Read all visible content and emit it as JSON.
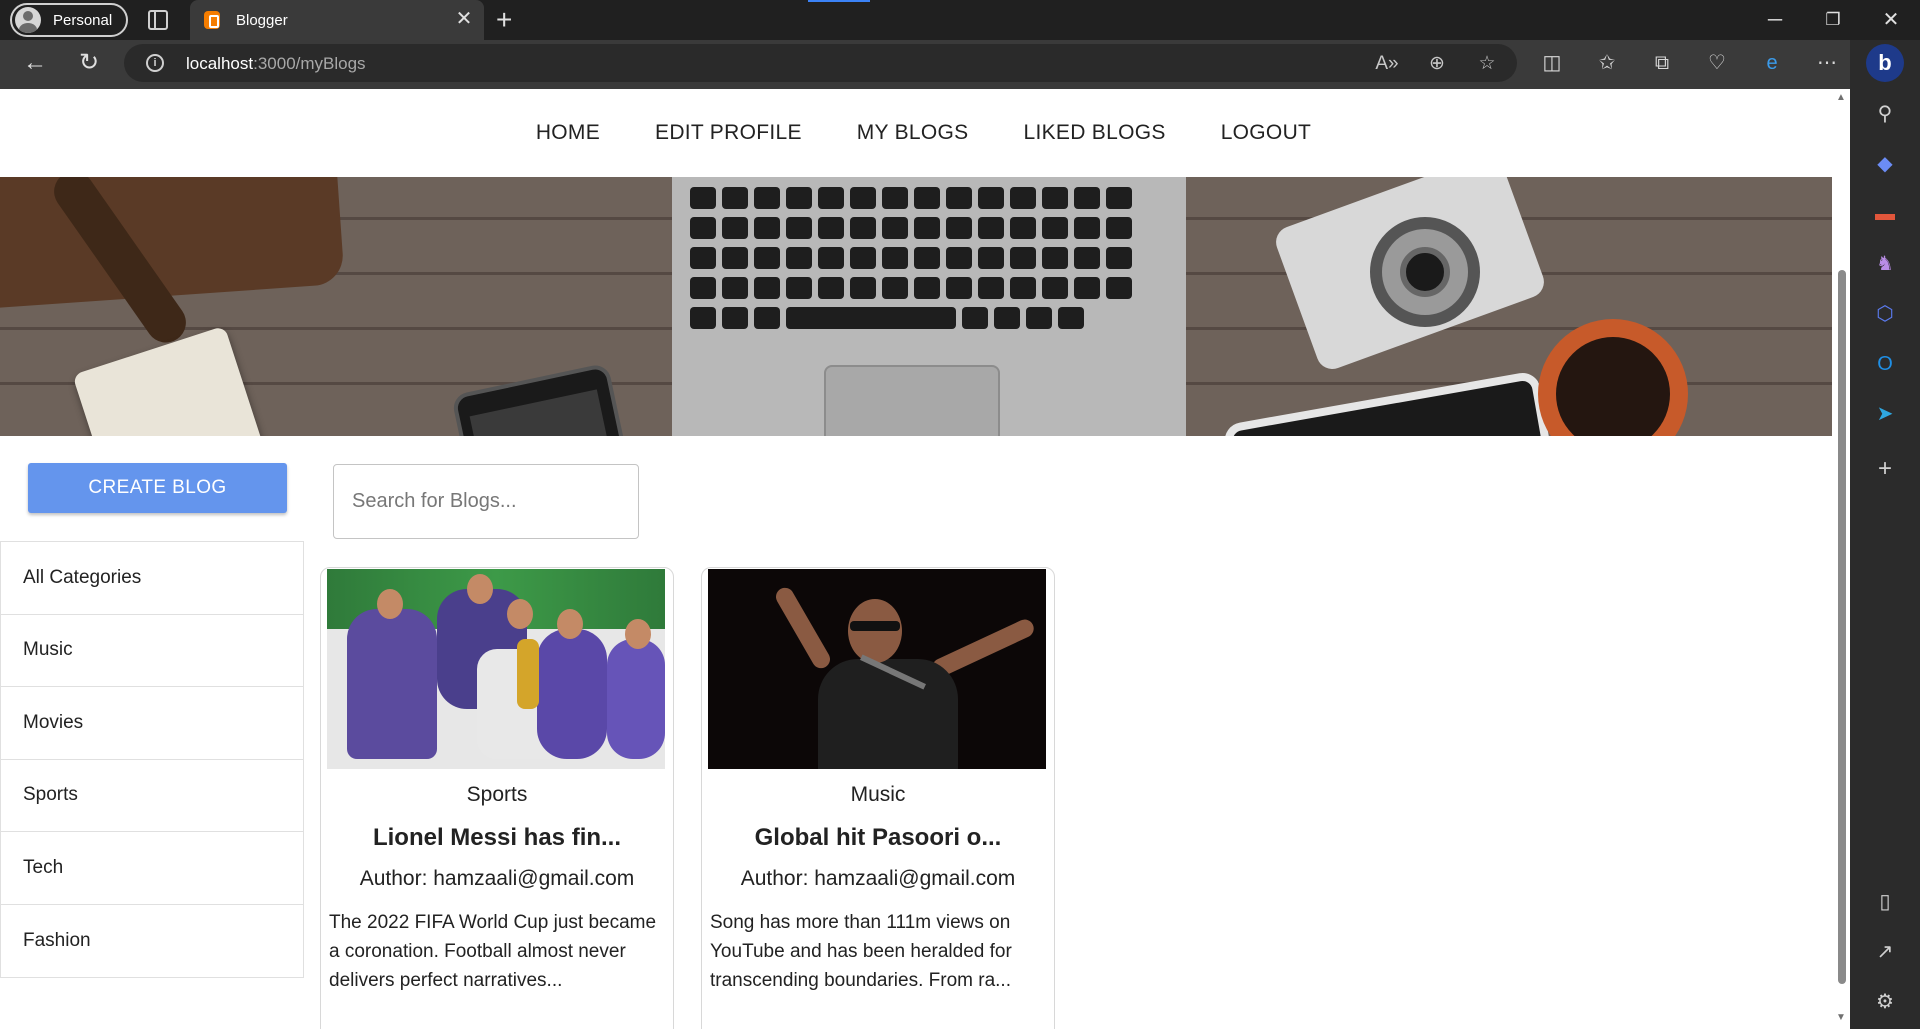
{
  "browser": {
    "profile_label": "Personal",
    "tab_title": "Blogger",
    "tab_close": "✕",
    "new_tab": "+",
    "window_controls": {
      "minimize": "─",
      "restore": "❐",
      "close": "✕"
    },
    "url_host": "localhost",
    "url_path": ":3000/myBlogs",
    "info_icon": "i",
    "icons": [
      "back-icon",
      "refresh-icon",
      "read-aloud-icon",
      "zoom-icon",
      "favorite-star-icon",
      "split-screen-icon",
      "favorites-icon",
      "collections-icon",
      "browser-essentials-icon",
      "edge-extension-icon",
      "more-icon"
    ]
  },
  "sidebar_icons": [
    "search-icon",
    "shopping-tag-icon",
    "tools-briefcase-icon",
    "games-icon",
    "copilot-icon",
    "outlook-icon",
    "send-icon",
    "add-icon",
    "sidebar-toggle-icon",
    "external-link-icon",
    "settings-icon"
  ],
  "nav": {
    "home": "HOME",
    "edit_profile": "EDIT PROFILE",
    "my_blogs": "MY BLOGS",
    "liked_blogs": "LIKED BLOGS",
    "logout": "LOGOUT"
  },
  "create_button": "CREATE BLOG",
  "search": {
    "placeholder": "Search for Blogs...",
    "value": ""
  },
  "categories": [
    "All Categories",
    "Music",
    "Movies",
    "Sports",
    "Tech",
    "Fashion"
  ],
  "blogs": [
    {
      "category": "Sports",
      "title": "Lionel Messi has fin...",
      "author": "Author: hamzaali@gmail.com",
      "description": "The 2022 FIFA World Cup just became a coronation. Football almost never delivers perfect narratives..."
    },
    {
      "category": "Music",
      "title": "Global hit Pasoori o...",
      "author": "Author: hamzaali@gmail.com",
      "description": "Song has more than 111m views on YouTube and has been heralded for transcending boundaries. From ra..."
    }
  ],
  "colors": {
    "accent_button": "#6495ed",
    "browser_titlebar": "#202020",
    "browser_toolbar": "#3a3a3a"
  }
}
